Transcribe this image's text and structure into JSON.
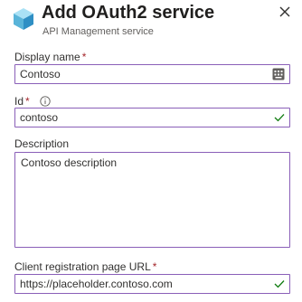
{
  "header": {
    "title": "Add OAuth2 service",
    "subtitle": "API Management service"
  },
  "form": {
    "display_name": {
      "label": "Display name",
      "required_mark": "*",
      "value": "Contoso"
    },
    "id": {
      "label": "Id",
      "required_mark": "*",
      "value": "contoso"
    },
    "description": {
      "label": "Description",
      "value": "Contoso description"
    },
    "client_registration_url": {
      "label": "Client registration page URL",
      "required_mark": "*",
      "value": "https://placeholder.contoso.com"
    }
  },
  "icons": {
    "logo": "api-management-cube-icon",
    "close": "close-icon",
    "info": "info-icon",
    "valid": "checkmark-icon",
    "autofill": "keyboard-icon"
  },
  "colors": {
    "input_border": "#8a5fb8",
    "valid_check": "#107c10",
    "required": "#a4262c"
  }
}
